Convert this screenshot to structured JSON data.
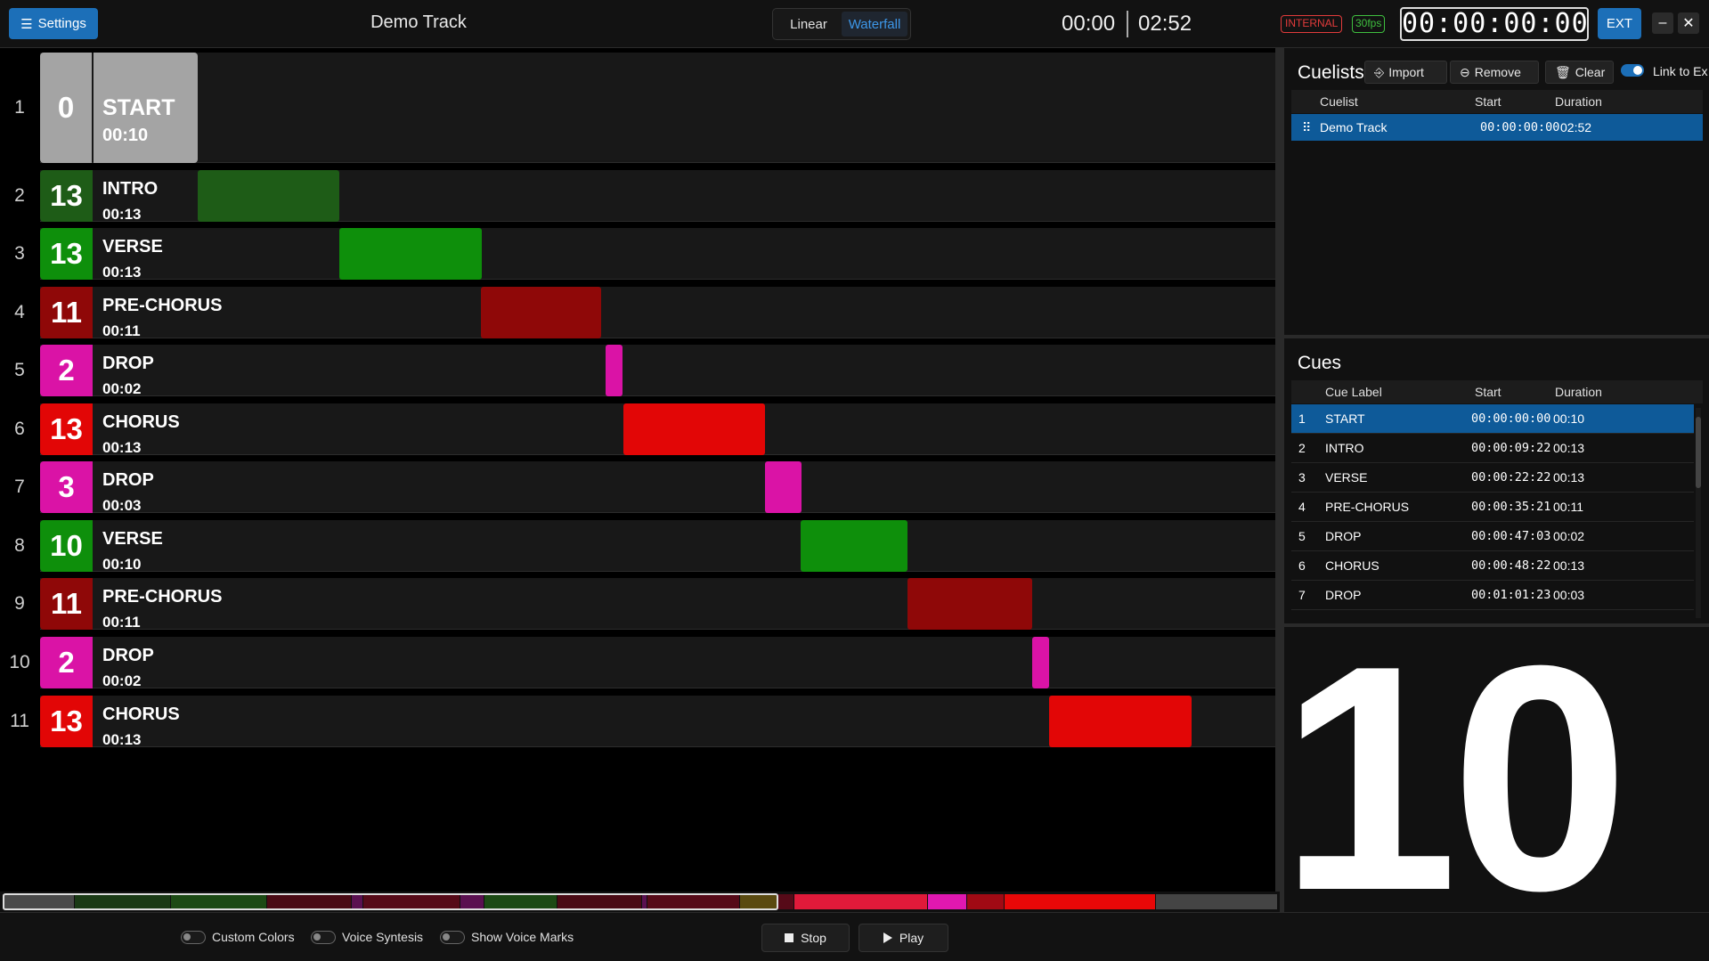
{
  "header": {
    "settings_label": "Settings",
    "track_title": "Demo Track",
    "view_modes": [
      {
        "label": "Linear",
        "active": false
      },
      {
        "label": "Waterfall",
        "active": true
      }
    ],
    "position": "00:00",
    "duration": "02:52",
    "clock_source": "INTERNAL",
    "fps": "30fps",
    "timecode": "00:00:00:00",
    "ext_label": "EXT",
    "minimize_glyph": "–",
    "close_glyph": "✕"
  },
  "colors": {
    "accent": "#1c6fb8",
    "start": "#a4a4a4",
    "intro": "#1e5c17",
    "verse": "#0e8f0b",
    "prechorus": "#8f0808",
    "drop": "#da13a6",
    "chorus": "#e20606"
  },
  "waterfall": {
    "rows": [
      {
        "index": "1",
        "count": "0",
        "label": "START",
        "duration": "00:10",
        "color": "#a4a4a4",
        "start": 0,
        "length": 10
      },
      {
        "index": "2",
        "count": "13",
        "label": "INTRO",
        "duration": "00:13",
        "color": "#1e5c17",
        "start": 9.73,
        "length": 13
      },
      {
        "index": "3",
        "count": "13",
        "label": "VERSE",
        "duration": "00:13",
        "color": "#0e8f0b",
        "start": 22.73,
        "length": 13
      },
      {
        "index": "4",
        "count": "11",
        "label": "PRE-CHORUS",
        "duration": "00:11",
        "color": "#8f0808",
        "start": 35.7,
        "length": 11
      },
      {
        "index": "5",
        "count": "2",
        "label": "DROP",
        "duration": "00:02",
        "color": "#da13a6",
        "start": 47.1,
        "length": 1.6
      },
      {
        "index": "6",
        "count": "13",
        "label": "CHORUS",
        "duration": "00:13",
        "color": "#e20606",
        "start": 48.73,
        "length": 13
      },
      {
        "index": "7",
        "count": "3",
        "label": "DROP",
        "duration": "00:03",
        "color": "#da13a6",
        "start": 61.77,
        "length": 3.3
      },
      {
        "index": "8",
        "count": "10",
        "label": "VERSE",
        "duration": "00:10",
        "color": "#0e8f0b",
        "start": 65.0,
        "length": 9.8
      },
      {
        "index": "9",
        "count": "11",
        "label": "PRE-CHORUS",
        "duration": "00:11",
        "color": "#8f0808",
        "start": 74.8,
        "length": 11.4
      },
      {
        "index": "10",
        "count": "2",
        "label": "DROP",
        "duration": "00:02",
        "color": "#da13a6",
        "start": 86.2,
        "length": 1.6
      },
      {
        "index": "11",
        "count": "13",
        "label": "CHORUS",
        "duration": "00:13",
        "color": "#e20606",
        "start": 87.8,
        "length": 13
      }
    ],
    "overview": [
      {
        "start": 0,
        "length": 9.7,
        "color": "#4a4a4a"
      },
      {
        "start": 9.7,
        "length": 13,
        "color": "#1a3a15"
      },
      {
        "start": 22.7,
        "length": 13,
        "color": "#1c4a14"
      },
      {
        "start": 35.7,
        "length": 11.4,
        "color": "#4a0a14"
      },
      {
        "start": 47.1,
        "length": 1.6,
        "color": "#5a1050"
      },
      {
        "start": 48.7,
        "length": 13,
        "color": "#560a18"
      },
      {
        "start": 61.7,
        "length": 3.3,
        "color": "#5a1050"
      },
      {
        "start": 65.0,
        "length": 9.8,
        "color": "#1c4a14"
      },
      {
        "start": 74.8,
        "length": 11.4,
        "color": "#4a0a14"
      },
      {
        "start": 86.2,
        "length": 0.8,
        "color": "#5a1050"
      },
      {
        "start": 87.0,
        "length": 12.5,
        "color": "#560a18"
      },
      {
        "start": 99.5,
        "length": 5,
        "color": "#5a4a10"
      },
      {
        "start": 104.5,
        "length": 2.3,
        "color": "#560a18"
      },
      {
        "start": 106.8,
        "length": 18,
        "color": "#e01a3a"
      },
      {
        "start": 124.8,
        "length": 5.3,
        "color": "#e018b0"
      },
      {
        "start": 130.1,
        "length": 5,
        "color": "#a00a14"
      },
      {
        "start": 135.1,
        "length": 20.5,
        "color": "#e80808"
      },
      {
        "start": 155.6,
        "length": 16.4,
        "color": "#444444"
      }
    ],
    "total_seconds": 172
  },
  "cuelists": {
    "title": "Cuelists",
    "import_label": "Import",
    "remove_label": "Remove",
    "clear_label": "Clear",
    "link_label": "Link to Ex",
    "columns": [
      "Cuelist",
      "Start",
      "Duration"
    ],
    "rows": [
      {
        "handle": "⠿",
        "name": "Demo Track",
        "start": "00:00:00:00",
        "duration": "02:52"
      }
    ]
  },
  "cues": {
    "title": "Cues",
    "columns": [
      "Cue Label",
      "Start",
      "Duration"
    ],
    "rows": [
      {
        "n": "1",
        "label": "START",
        "start": "00:00:00:00",
        "duration": "00:10",
        "selected": true
      },
      {
        "n": "2",
        "label": "INTRO",
        "start": "00:00:09:22",
        "duration": "00:13"
      },
      {
        "n": "3",
        "label": "VERSE",
        "start": "00:00:22:22",
        "duration": "00:13"
      },
      {
        "n": "4",
        "label": "PRE-CHORUS",
        "start": "00:00:35:21",
        "duration": "00:11"
      },
      {
        "n": "5",
        "label": "DROP",
        "start": "00:00:47:03",
        "duration": "00:02"
      },
      {
        "n": "6",
        "label": "CHORUS",
        "start": "00:00:48:22",
        "duration": "00:13"
      },
      {
        "n": "7",
        "label": "DROP",
        "start": "00:01:01:23",
        "duration": "00:03"
      }
    ]
  },
  "countdown": "10",
  "footer": {
    "toggles": [
      {
        "label": "Custom Colors",
        "on": false
      },
      {
        "label": "Voice Syntesis",
        "on": false
      },
      {
        "label": "Show Voice Marks",
        "on": false
      }
    ],
    "stop_label": "Stop",
    "play_label": "Play"
  }
}
